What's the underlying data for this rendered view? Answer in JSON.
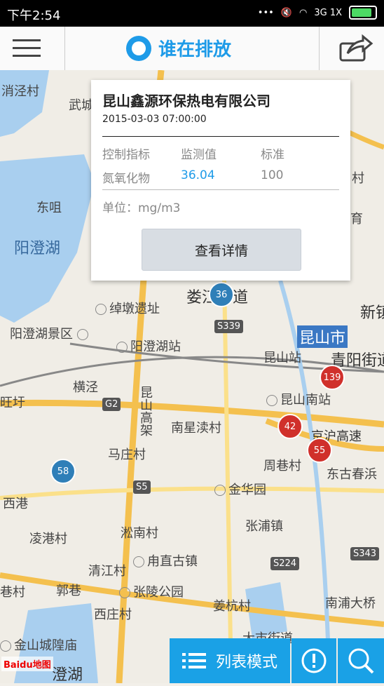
{
  "status_bar": {
    "time": "下午2:54",
    "network": "3G 1X"
  },
  "app_bar": {
    "title": "谁在排放"
  },
  "popup": {
    "company": "昆山鑫源环保热电有限公司",
    "datetime": "2015-03-03 07:00:00",
    "headers": [
      "控制指标",
      "监测值",
      "标准"
    ],
    "row": {
      "indicator": "氮氧化物",
      "value": "36.04",
      "standard": "100"
    },
    "unit": "单位：mg/m3",
    "detail_button": "查看详情"
  },
  "map_labels": [
    "消泾村",
    "武城",
    "东咀",
    "阳澄湖",
    "绰墩遗址",
    "阳澄湖景区",
    "阳澄湖站",
    "横泾",
    "旺圩",
    "马庄村",
    "西港",
    "凌港村",
    "淞南村",
    "清江村",
    "甪直古镇",
    "郭巷",
    "张陵公园",
    "西庄村",
    "金山城隍庙",
    "澄湖",
    "娄江街道",
    "昆山市",
    "新镇",
    "青阳街道",
    "昆山站",
    "昆山南站",
    "南星渎村",
    "京沪高速",
    "周巷村",
    "东古春浜",
    "金华园",
    "张浦镇",
    "姜杭村",
    "南浦大桥",
    "大市街道",
    "昆山高架",
    "育",
    "村",
    "巷村"
  ],
  "highway_shields": [
    "S339",
    "G2",
    "S5",
    "S224",
    "S343"
  ],
  "markers": [
    {
      "value": "36",
      "color": "#2f7fb8"
    },
    {
      "value": "139",
      "color": "#d0302b"
    },
    {
      "value": "42",
      "color": "#d0302b"
    },
    {
      "value": "55",
      "color": "#d0302b"
    },
    {
      "value": "58",
      "color": "#2f7fb8"
    }
  ],
  "bottom_bar": {
    "list_mode": "列表模式"
  },
  "baidu_logo": "Baidu地图"
}
